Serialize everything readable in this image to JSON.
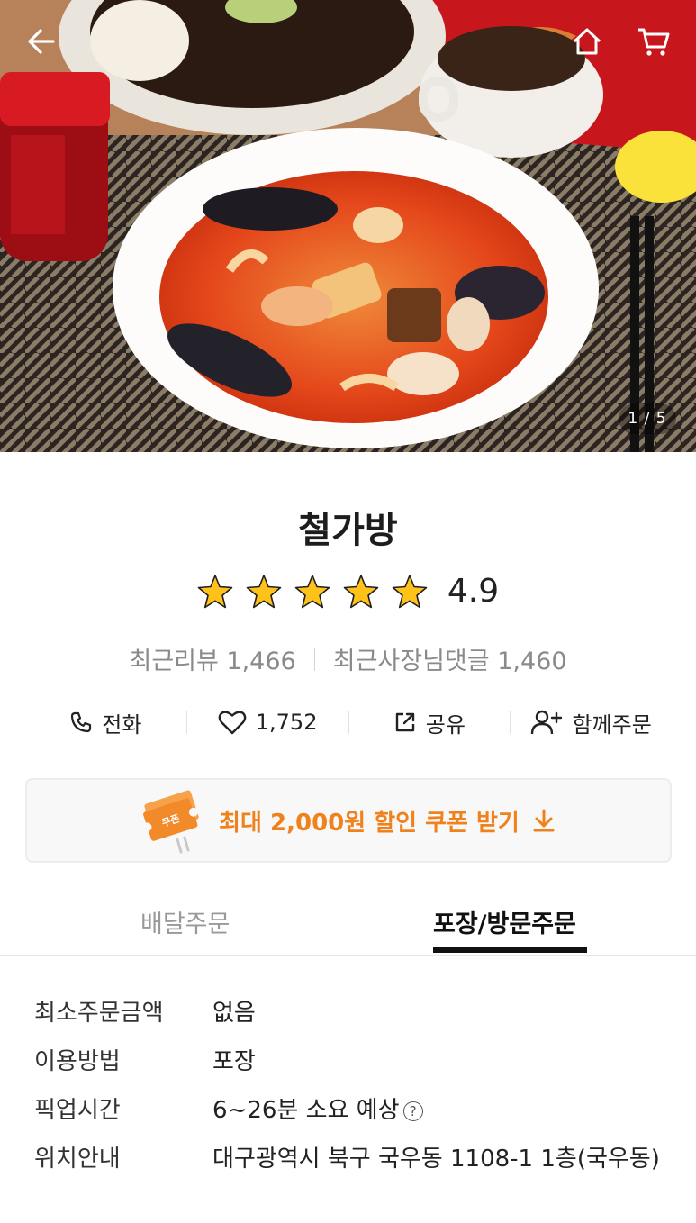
{
  "hero": {
    "image_counter": "1 / 5",
    "icons": {
      "back": "arrow-left-icon",
      "home": "home-icon",
      "cart": "cart-icon"
    }
  },
  "store": {
    "name": "철가방",
    "rating": "4.9",
    "rating_stars": 5,
    "recent_reviews_label": "최근리뷰 1,466",
    "owner_replies_label": "최근사장님댓글 1,460"
  },
  "actions": {
    "call": "전화",
    "like_count": "1,752",
    "share": "공유",
    "group_order": "함께주문"
  },
  "coupon": {
    "badge": "쿠폰",
    "text": "최대 2,000원 할인 쿠폰 받기"
  },
  "tabs": {
    "delivery": "배달주문",
    "pickup": "포장/방문주문",
    "active": "pickup"
  },
  "info": {
    "rows": [
      {
        "label": "최소주문금액",
        "value": "없음"
      },
      {
        "label": "이용방법",
        "value": "포장"
      },
      {
        "label": "픽업시간",
        "value": "6~26분 소요 예상"
      },
      {
        "label": "위치안내",
        "value": "대구광역시 북구 국우동 1108-1 1층(국우동)"
      }
    ],
    "help_glyph": "?"
  },
  "colors": {
    "accent": "#f0821e",
    "star": "#ffc21a",
    "muted": "#8a8a8a"
  }
}
